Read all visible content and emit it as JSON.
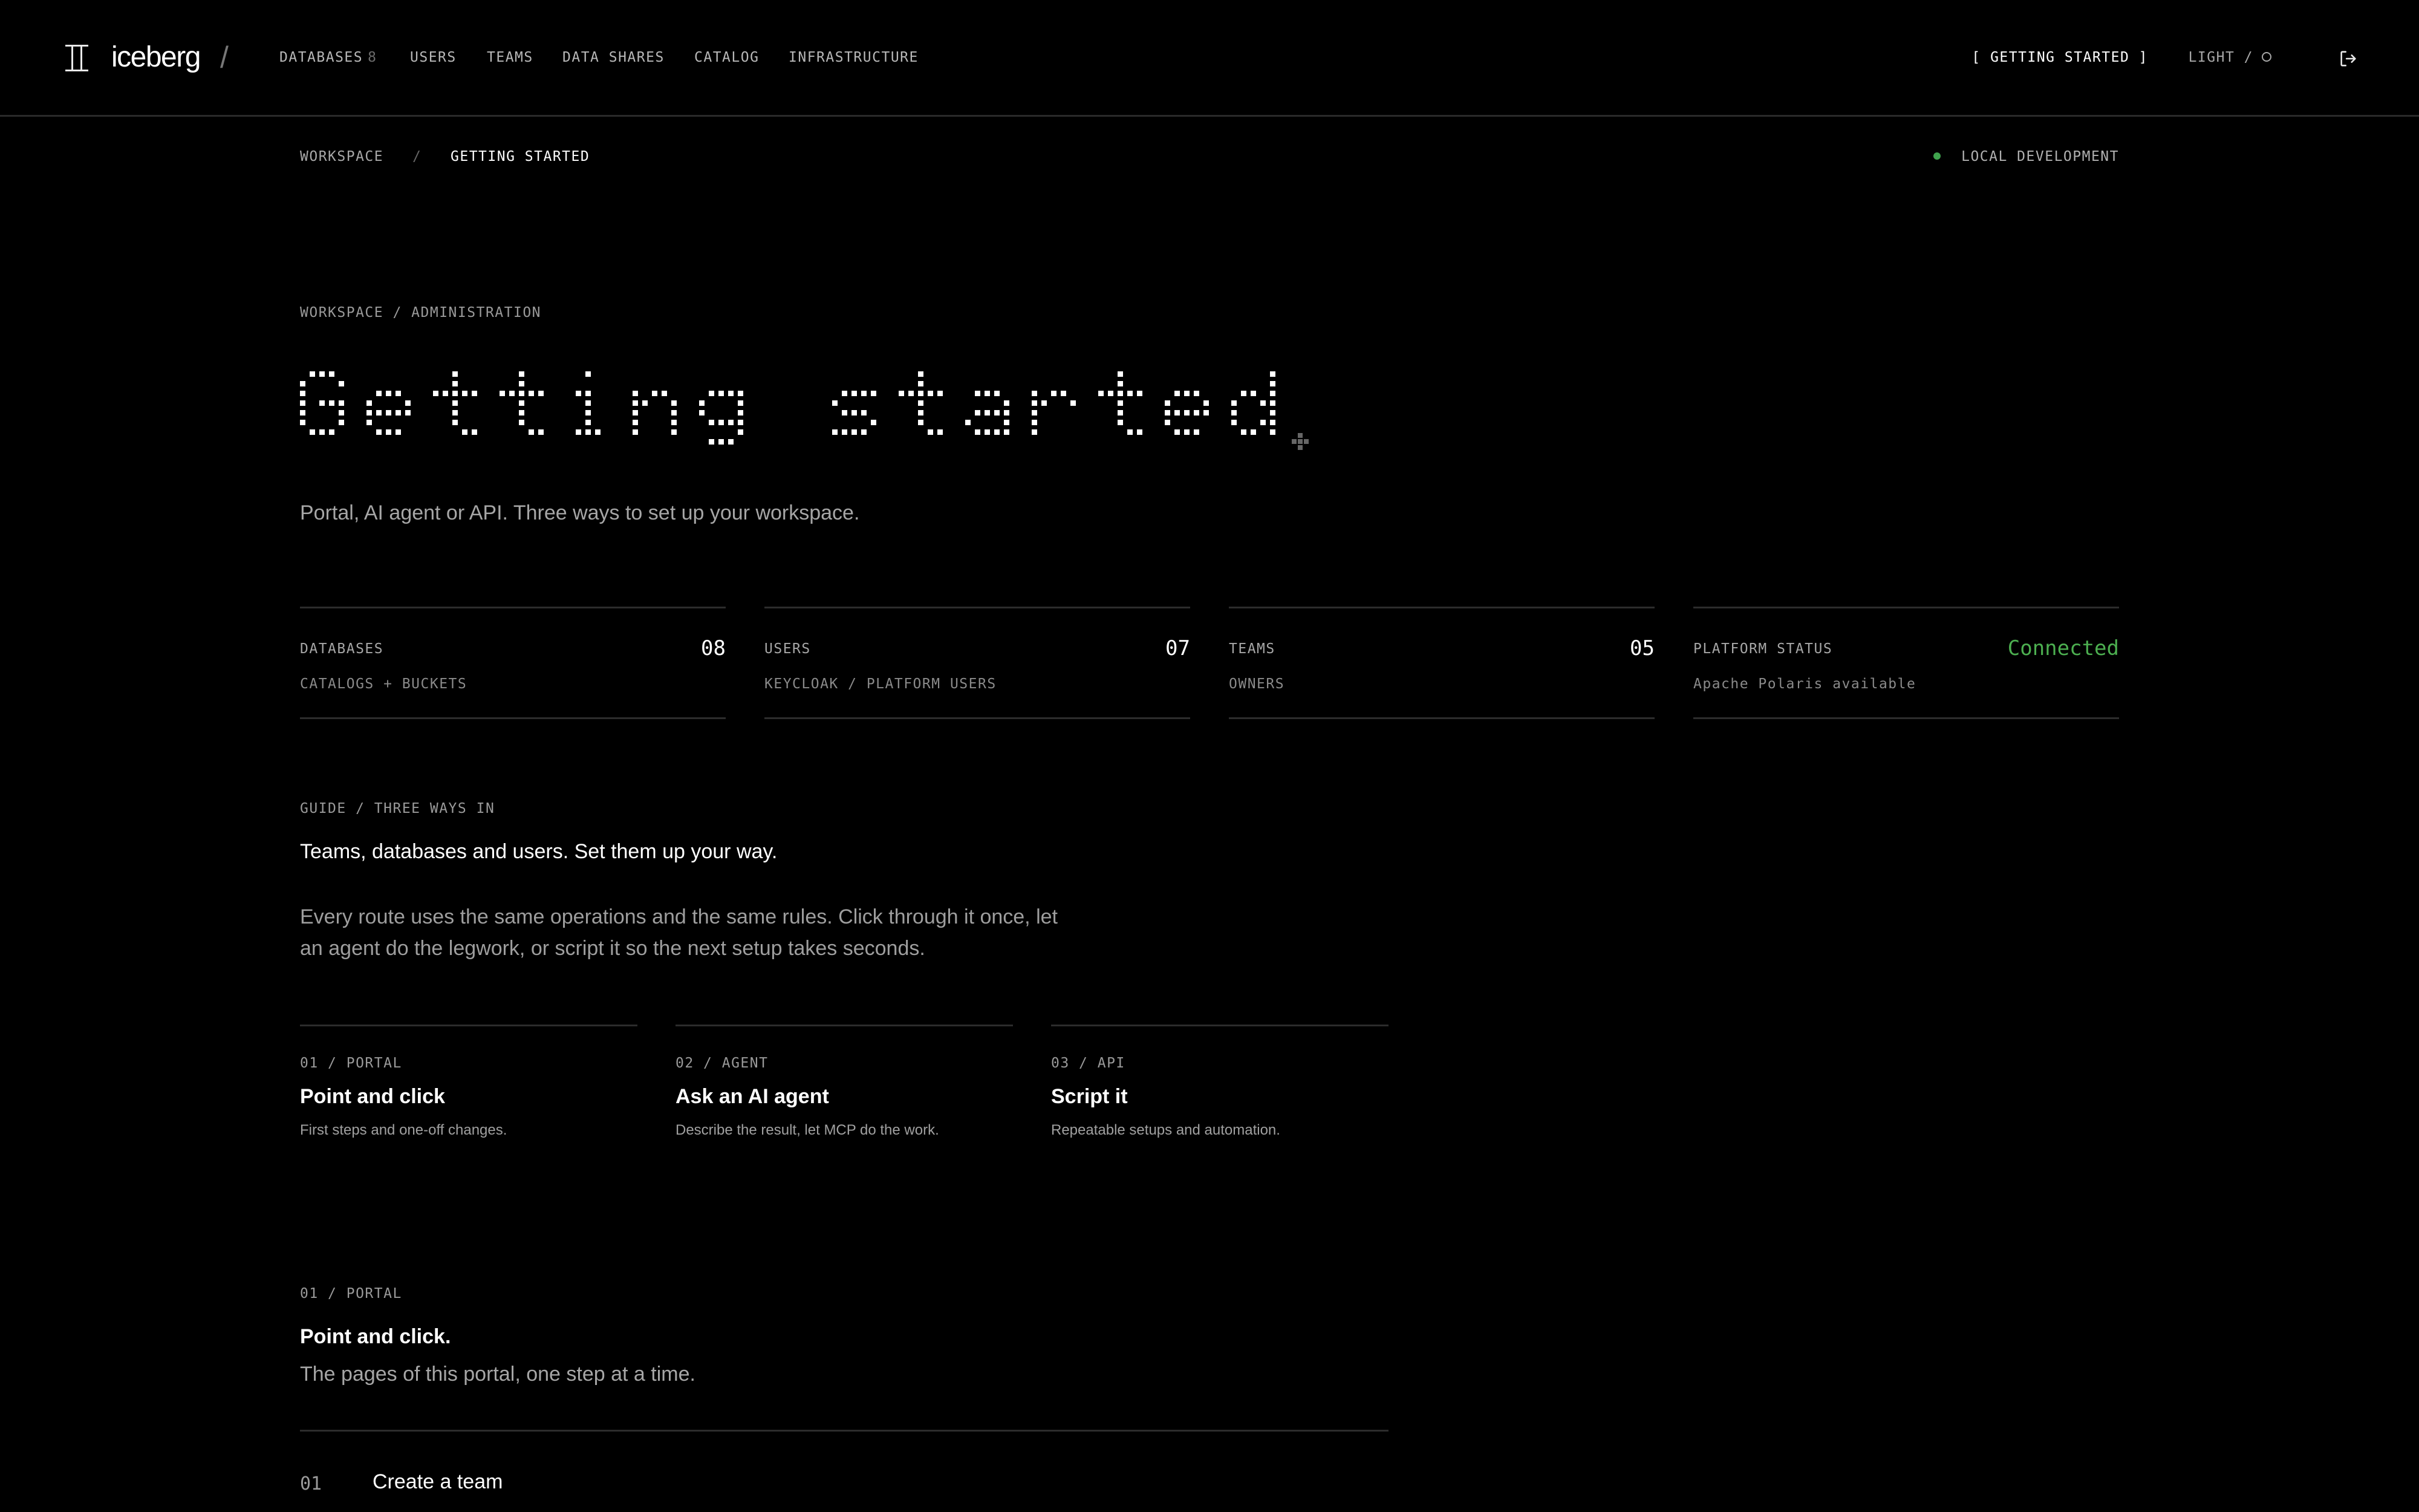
{
  "header": {
    "logo_text": "iceberg",
    "logo_separator": "/",
    "nav": [
      {
        "label": "DATABASES",
        "count": "8"
      },
      {
        "label": "USERS"
      },
      {
        "label": "TEAMS"
      },
      {
        "label": "DATA SHARES"
      },
      {
        "label": "CATALOG"
      },
      {
        "label": "INFRASTRUCTURE"
      }
    ],
    "getting_started_label": "[ GETTING STARTED ]",
    "theme_label": "LIGHT /",
    "icons": {
      "logo": "iceberg-logo-icon",
      "theme": "circle-icon",
      "logout": "logout-icon"
    }
  },
  "breadcrumb": {
    "root": "WORKSPACE",
    "separator": "/",
    "current": "GETTING STARTED"
  },
  "environment": {
    "label": "LOCAL DEVELOPMENT",
    "status_color": "#3fa34d"
  },
  "hero": {
    "eyebrow": "WORKSPACE / ADMINISTRATION",
    "title": "Getting started",
    "subtitle": "Portal, AI agent or API. Three ways to set up your workspace."
  },
  "stats": [
    {
      "label": "DATABASES",
      "value": "08",
      "sub": "CATALOGS + BUCKETS"
    },
    {
      "label": "USERS",
      "value": "07",
      "sub": "KEYCLOAK / PLATFORM USERS"
    },
    {
      "label": "TEAMS",
      "value": "05",
      "sub": "OWNERS"
    },
    {
      "label": "PLATFORM STATUS",
      "value": "Connected",
      "sub": "Apache Polaris available",
      "value_color": "#4caf50"
    }
  ],
  "guide": {
    "eyebrow": "GUIDE / THREE WAYS IN",
    "heading": "Teams, databases and users. Set them up your way.",
    "body": "Every route uses the same operations and the same rules. Click through it once, let an agent do the legwork, or script it so the next setup takes seconds.",
    "routes": [
      {
        "eyebrow": "01 / PORTAL",
        "title": "Point and click",
        "desc": "First steps and one-off changes."
      },
      {
        "eyebrow": "02 / AGENT",
        "title": "Ask an AI agent",
        "desc": "Describe the result, let MCP do the work."
      },
      {
        "eyebrow": "03 / API",
        "title": "Script it",
        "desc": "Repeatable setups and automation."
      }
    ]
  },
  "portal_section": {
    "eyebrow": "01 / PORTAL",
    "title": "Point and click.",
    "subtitle": "The pages of this portal, one step at a time.",
    "steps": [
      {
        "num": "01",
        "title": "Create a team"
      }
    ]
  }
}
